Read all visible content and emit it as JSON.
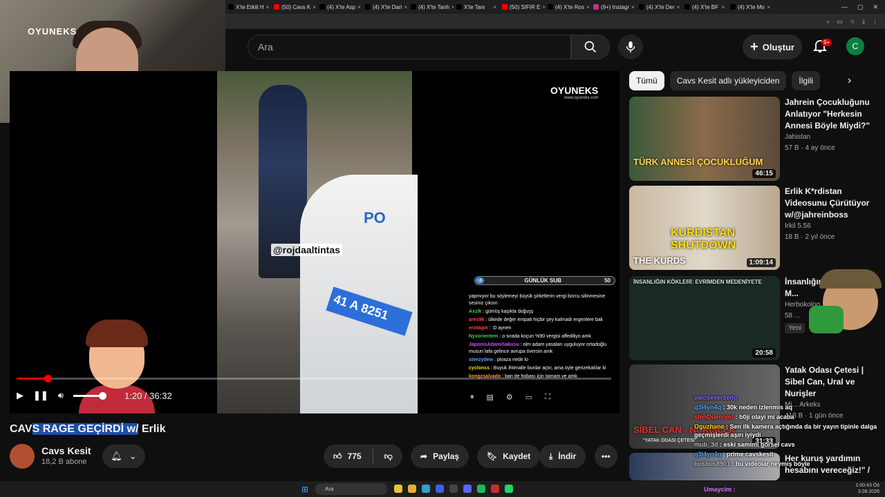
{
  "browser": {
    "tabs": [
      {
        "label": "X'te Etkili H",
        "icon": "x-icon",
        "color": "#000000"
      },
      {
        "label": "(50) Cavs K",
        "icon": "youtube-icon",
        "color": "#ff0000"
      },
      {
        "label": "(4) X'te Asp",
        "icon": "x-icon",
        "color": "#000000"
      },
      {
        "label": "(4) X'te Dari",
        "icon": "x-icon",
        "color": "#000000"
      },
      {
        "label": "(4) X'te Tanh",
        "icon": "x-icon",
        "color": "#000000"
      },
      {
        "label": "X'te Tanı",
        "icon": "x-icon",
        "color": "#000000"
      },
      {
        "label": "(50) SIFIR E",
        "icon": "youtube-icon",
        "color": "#ff0000"
      },
      {
        "label": "(4) X'te Ros",
        "icon": "x-icon",
        "color": "#000000"
      },
      {
        "label": "(9+) Instagr",
        "icon": "instagram-icon",
        "color": "#c13584"
      },
      {
        "label": "(4) X'te Der",
        "icon": "x-icon",
        "color": "#000000"
      },
      {
        "label": "(4) X'te BF",
        "icon": "x-icon",
        "color": "#000000"
      },
      {
        "label": "(4) X'te Mo",
        "icon": "x-icon",
        "color": "#000000"
      }
    ]
  },
  "webcam": {
    "logo_text": "OYUNEKS"
  },
  "header": {
    "search_placeholder": "Ara",
    "create_label": "Oluştur",
    "notif_badge": "9+",
    "avatar_letter": "C"
  },
  "player": {
    "watermark": "OYUNEKS",
    "watermark_url": "www.oyuneks.com",
    "handle": "@rojdaaltintas",
    "plate": "41 A 8251",
    "car_text": "PO",
    "time_current": "1:20",
    "time_total": "36:32",
    "time_display": "1:20 / 36:32",
    "progress_fraction": 0.036,
    "sub_goal_label": "GÜNLÜK SUB",
    "sub_goal_current": "4",
    "sub_goal_target": "50",
    "chat": [
      {
        "user": "",
        "msg": "yapmıyor bu söylemeyi büyük şirketlerin vergi borcu silinmesine sesiniz çıksın",
        "cls": ""
      },
      {
        "user": "Axzik",
        "msg": " : gümüş kaşıkla doğuşş",
        "cls": "u-g"
      },
      {
        "user": "ares96",
        "msg": " : ülkede değer empati hiçbir şey kalmadı ergenlere bak",
        "cls": "u-r"
      },
      {
        "user": "erotagin",
        "msg": " : :D aynen",
        "cls": "u-r"
      },
      {
        "user": "Nyxorientem",
        "msg": " : o sırada koçun %90 vergisi affediliyo amk",
        "cls": "u-g"
      },
      {
        "user": "JaponisAdamiSakusu",
        "msg": " : olm adam yasaları uyguluyor ortadoğlu musun lafa gelince avrupa översin amk",
        "cls": "u-p"
      },
      {
        "user": "steezydew",
        "msg": " : pivaza nedir lo",
        "cls": "u-b"
      },
      {
        "user": "cyclonss",
        "msg": " : Buyuk ihtimalle bunlar açtır, ama öyle gerizekalılar ki",
        "cls": "u-y"
      },
      {
        "user": "kongzsalvado",
        "msg": " : ban de hobası için tamam ve amk",
        "cls": "u-o"
      }
    ]
  },
  "video": {
    "title_part1": "CAV",
    "title_part2": "S RAGE GEÇİRDİ w/",
    "title_part3": " Erlik",
    "channel": "Cavs Kesit",
    "subs": "18,2 B abone",
    "likes": "775",
    "share_label": "Paylaş",
    "save_label": "Kaydet",
    "download_label": "İndir"
  },
  "sidebar": {
    "chips": [
      "Tümü",
      "Cavs Kesit adlı yükleyiciden",
      "İlgili"
    ],
    "recs": [
      {
        "title": "Jahrein Çocukluğunu Anlatıyor \"Herkesin Annesi Böyle Miydi?\"",
        "channel": "Jahistan",
        "meta": "57 B  ·  4 ay önce",
        "duration": "46:15",
        "thumb_text": "TÜRK ANNESİ ÇOCUKLUĞUM",
        "new": ""
      },
      {
        "title": "Erlik K*rdistan Videosunu Çürütüyor w/@jahreinboss",
        "channel": "Irkil 5.56",
        "meta": "18 B  ·  2 yıl önce",
        "duration": "1:09:14",
        "thumb_text": "THE KURDS",
        "thumb_text2": "KURDISTAN SHUTDOWN",
        "new": ""
      },
      {
        "title": "İnsanlığın K... Evrimden M...",
        "channel": "Herbokolog...",
        "meta": "58 ...",
        "duration": "20:58",
        "thumb_text": "İNSANLIĞIN KÖKLERİ: EVRİMDEN MEDENİYETE",
        "new": "Yeni"
      },
      {
        "title": "Yatak Odası Çetesi | Sibel Can, Ural ve Nurişler",
        "channel": "Mi... Arkeks",
        "meta": "418 B  ·  1 gün önce",
        "duration": "31:33",
        "thumb_text": "SİBEL CAN - NURİŞLER",
        "thumb_sub": "\"YATAK ODASI ÇETESİ\"",
        "new": ""
      },
      {
        "title": "Her kuruş yardımın hesabını vereceğiz!\" /",
        "channel": "",
        "meta": "",
        "duration": "",
        "thumb_text": "",
        "new": ""
      }
    ]
  },
  "overlay_chat": [
    {
      "user": "valoseverseno",
      "msg": ""
    },
    {
      "user": "q3l4yn4q",
      "msg": " : 30k neden izlenmis aq"
    },
    {
      "user": "shinDiamond",
      "msg": " : b0ji olayi mi acaba"
    },
    {
      "user": "Oguzhane",
      "msg": " : Sen ilk kamera açtığında da bir yayın tipinle dalga geçmişlerdi aşırı iyiydi"
    },
    {
      "user": "mub_3d",
      "msg": " : eski samimi görsel cavs"
    },
    {
      "user": "q3l4yn4q",
      "msg": " : prime cavskesit"
    },
    {
      "user": "busbus8901",
      "msg": " : bu videolar neymiş böyle"
    }
  ],
  "overlay_user": "Umaycim :",
  "taskbar": {
    "search": "Ara",
    "time": "1:00:43 Öö",
    "date": "3.08.2026"
  },
  "colors": {
    "accent": "#ff0000",
    "bg": "#0f0f0f",
    "chip_active": "#f1f1f1"
  }
}
